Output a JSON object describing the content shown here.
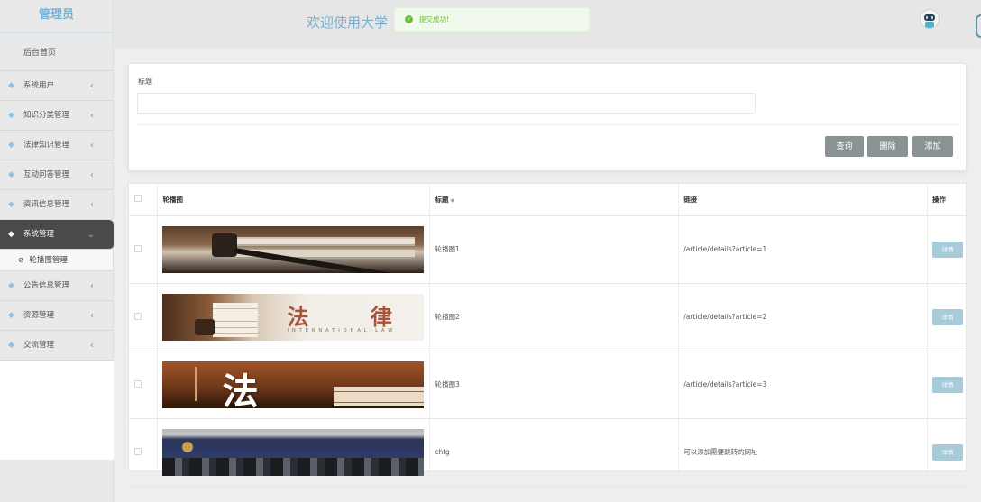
{
  "sidebar": {
    "brand": "管理员",
    "home": "后台首页",
    "items": [
      {
        "label": "系统用户"
      },
      {
        "label": "知识分类管理"
      },
      {
        "label": "法律知识管理"
      },
      {
        "label": "互动问答管理"
      },
      {
        "label": "资讯信息管理"
      },
      {
        "label": "系统管理",
        "active": true
      },
      {
        "label": "公告信息管理"
      },
      {
        "label": "资源管理"
      },
      {
        "label": "交流管理"
      }
    ],
    "submenu": {
      "label": "轮播图管理"
    }
  },
  "header": {
    "welcome": "欢迎使用大学"
  },
  "toast": {
    "message": "提交成功!",
    "type": "success"
  },
  "search": {
    "label": "标题",
    "value": "",
    "placeholder": "",
    "buttons": {
      "query": "查询",
      "delete": "删除",
      "add": "添加"
    }
  },
  "table": {
    "headers": {
      "image": "轮播图",
      "title": "标题",
      "link": "链接",
      "action": "操作"
    },
    "rows": [
      {
        "title": "轮播图1",
        "link": "/article/details?article=1",
        "action": "详情",
        "thumb": "gavel-books"
      },
      {
        "title": "轮播图2",
        "link": "/article/details?article=2",
        "action": "详情",
        "thumb": "international-law",
        "thumb_text": "法 律",
        "thumb_sub": "INTERNATIONAL LAW"
      },
      {
        "title": "轮播图3",
        "link": "/article/details?article=3",
        "action": "详情",
        "thumb": "law-banner",
        "thumb_text": "法 律"
      },
      {
        "title": "chfg",
        "link": "可以添加需要跳转的网址",
        "action": "详情",
        "thumb": "meeting-hall"
      }
    ]
  },
  "colors": {
    "accent": "#7ab0cf",
    "button": "#8a9393",
    "detail_button": "#a7cbd9",
    "success": "#67c23a",
    "sidebar_active": "#4a4a4a"
  }
}
